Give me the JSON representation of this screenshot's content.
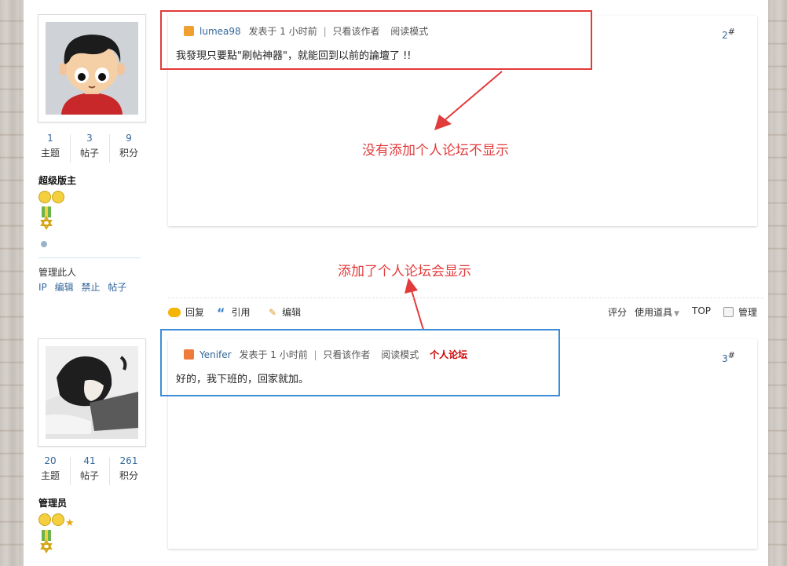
{
  "post1": {
    "author": "lumea98",
    "posted": "发表于 1 小时前",
    "only_author": "只看该作者",
    "read_mode": "阅读模式",
    "content": "我發現只要點\"刷帖神器\"，就能回到以前的論壇了 !!",
    "floor": "2",
    "floor_mark": "#"
  },
  "post2": {
    "author": "Yenifer",
    "posted": "发表于 1 小时前",
    "only_author": "只看该作者",
    "read_mode": "阅读模式",
    "personal_forum": "个人论坛",
    "content": "好的，我下班的，回家就加。",
    "floor": "3",
    "floor_mark": "#"
  },
  "user1": {
    "stats": [
      {
        "num": "1",
        "label": "主题"
      },
      {
        "num": "3",
        "label": "帖子"
      },
      {
        "num": "9",
        "label": "积分"
      }
    ],
    "rank": "超级版主",
    "manage_label": "管理此人",
    "manage_links": [
      "IP",
      "编辑",
      "禁止",
      "帖子"
    ]
  },
  "user2": {
    "stats": [
      {
        "num": "20",
        "label": "主题"
      },
      {
        "num": "41",
        "label": "帖子"
      },
      {
        "num": "261",
        "label": "积分"
      }
    ],
    "rank": "管理员"
  },
  "actions": {
    "reply": "回复",
    "quote": "引用",
    "edit": "编辑",
    "rate": "评分",
    "use_tool": "使用道具",
    "top": "TOP",
    "manage": "管理"
  },
  "annotations": {
    "no_forum": "没有添加个人论坛不显示",
    "has_forum": "添加了个人论坛会显示"
  },
  "colors": {
    "annotation_red": "#e23b3b",
    "highlight_blue": "#3d8ed6",
    "link_blue": "#336699",
    "forum_red": "#cc0000"
  }
}
